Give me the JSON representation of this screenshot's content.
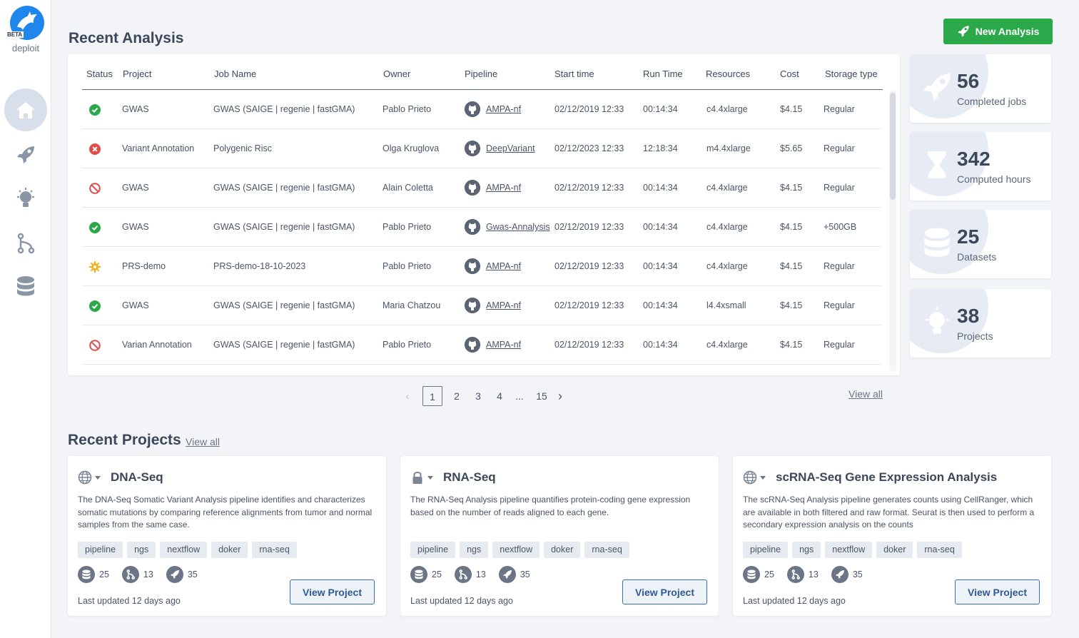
{
  "app": {
    "name": "deploit",
    "badge": "BETA"
  },
  "sidebar": {
    "items": [
      {
        "icon": "home-icon",
        "active": true
      },
      {
        "icon": "rocket-icon",
        "active": false
      },
      {
        "icon": "lightbulb-icon",
        "active": false
      },
      {
        "icon": "pipeline-branch-icon",
        "active": false
      },
      {
        "icon": "database-icon",
        "active": false
      }
    ]
  },
  "header": {
    "title": "Recent Analysis",
    "new_button": "New Analysis"
  },
  "table": {
    "columns": [
      "Status",
      "Project",
      "Job Name",
      "Owner",
      "Pipeline",
      "Start time",
      "Run Time",
      "Resources",
      "Cost",
      "Storage type"
    ],
    "rows": [
      {
        "status": "completed",
        "project": "GWAS",
        "job": "GWAS (SAIGE | regenie | fastGMA)",
        "owner": "Pablo Prieto",
        "pipeline": "AMPA-nf",
        "start": "02/12/2019 12:33",
        "run": "00:14:34",
        "resources": "c4.4xlarge",
        "cost": "$4.15",
        "storage": "Regular"
      },
      {
        "status": "failed",
        "project": "Variant Annotation",
        "job": "Polygenic Risc",
        "owner": "Olga Kruglova",
        "pipeline": "DeepVariant",
        "start": "02/12/2023 12:33",
        "run": "12:18:34",
        "resources": "m4.4xlarge",
        "cost": "$5.65",
        "storage": "Regular"
      },
      {
        "status": "aborted",
        "project": "GWAS",
        "job": "GWAS (SAIGE | regenie | fastGMA)",
        "owner": "Alain Coletta",
        "pipeline": "AMPA-nf",
        "start": "02/12/2019 12:33",
        "run": "00:14:34",
        "resources": "c4.4xlarge",
        "cost": "$4.15",
        "storage": "Regular"
      },
      {
        "status": "completed",
        "project": "GWAS",
        "job": "GWAS (SAIGE | regenie | fastGMA)",
        "owner": "Pablo Prieto",
        "pipeline": "Gwas-Annalysis",
        "start": "02/12/2019 12:33",
        "run": "00:14:34",
        "resources": "c4.4xlarge",
        "cost": "$4.15",
        "storage": "+500GB"
      },
      {
        "status": "running",
        "project": "PRS-demo",
        "job": "PRS-demo-18-10-2023",
        "owner": "Pablo Prieto",
        "pipeline": "AMPA-nf",
        "start": "02/12/2019 12:33",
        "run": "00:14:34",
        "resources": "c4.4xlarge",
        "cost": "$4.15",
        "storage": "Regular"
      },
      {
        "status": "completed",
        "project": "GWAS",
        "job": "GWAS (SAIGE | regenie | fastGMA)",
        "owner": "Maria Chatzou",
        "pipeline": "AMPA-nf",
        "start": "02/12/2019 12:33",
        "run": "00:14:34",
        "resources": "l4.4xsmall",
        "cost": "$4.15",
        "storage": "Regular"
      },
      {
        "status": "aborted",
        "project": "Varian Annotation",
        "job": "GWAS (SAIGE | regenie | fastGMA)",
        "owner": "Pablo Prieto",
        "pipeline": "AMPA-nf",
        "start": "02/12/2019 12:33",
        "run": "00:14:34",
        "resources": "c4.4xlarge",
        "cost": "$4.15",
        "storage": "Regular"
      }
    ]
  },
  "stats": [
    {
      "icon": "rocket-icon",
      "value": "56",
      "label": "Completed jobs"
    },
    {
      "icon": "hourglass-icon",
      "value": "342",
      "label": "Computed hours"
    },
    {
      "icon": "database-icon",
      "value": "25",
      "label": "Datasets"
    },
    {
      "icon": "lightbulb-icon",
      "value": "38",
      "label": "Projects"
    }
  ],
  "pagination": {
    "pages": [
      "1",
      "2",
      "3",
      "4",
      "...",
      "15"
    ],
    "current": "1",
    "view_all": "View all"
  },
  "projects": {
    "title": "Recent Projects",
    "view_all": "View all",
    "cards": [
      {
        "visibility": "globe-icon",
        "title": "DNA-Seq",
        "description": "The DNA-Seq Somatic Variant Analysis pipeline identifies and characterizes somatic mutations by comparing reference alignments from tumor and normal samples from the same case.",
        "tags": [
          "pipeline",
          "ngs",
          "nextflow",
          "doker",
          "rna-seq"
        ],
        "datasets": "25",
        "pipelines": "13",
        "jobs": "35",
        "updated": "Last updated 12 days ago",
        "button": "View Project"
      },
      {
        "visibility": "lock-icon",
        "title": "RNA-Seq",
        "description": "The RNA-Seq Analysis pipeline quantifies protein-coding gene expression based on the number of reads aligned to each gene.",
        "tags": [
          "pipeline",
          "ngs",
          "nextflow",
          "doker",
          "rna-seq"
        ],
        "datasets": "25",
        "pipelines": "13",
        "jobs": "35",
        "updated": "Last updated 12 days ago",
        "button": "View Project"
      },
      {
        "visibility": "globe-icon",
        "title": "scRNA-Seq Gene Expression Analysis",
        "description": "The scRNA-Seq Analysis pipeline generates counts using CellRanger, which are available in both filtered and raw format. Seurat is then used to perform a secondary expression analysis on the counts",
        "tags": [
          "pipeline",
          "ngs",
          "nextflow",
          "doker",
          "rna-seq"
        ],
        "datasets": "25",
        "pipelines": "13",
        "jobs": "35",
        "updated": "Last updated 12 days ago",
        "button": "View Project"
      }
    ]
  },
  "colors": {
    "success": "#2aa84a",
    "error": "#e24b4b",
    "warning": "#f2b01e",
    "link": "#2e5a96"
  }
}
